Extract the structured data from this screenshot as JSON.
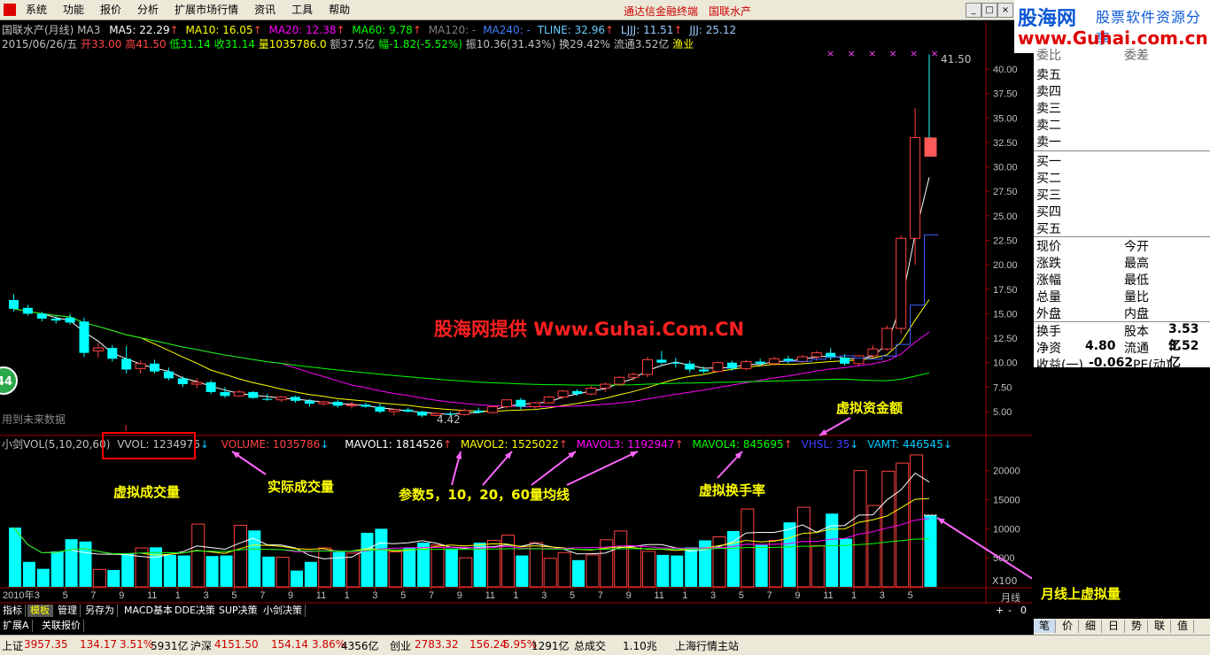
{
  "menu": {
    "items": [
      "系统",
      "功能",
      "报价",
      "分析",
      "扩展市场行情",
      "资讯",
      "工具",
      "帮助"
    ],
    "promo": "通达信金融终端",
    "stock": "国联水产"
  },
  "logo": {
    "name": "股海网",
    "tagline": "股票软件资源分享",
    "url": "www.Guhai.com.cn"
  },
  "chart_header": {
    "title": "国联水产(月线) MA3",
    "ma5": "MA5: 22.29",
    "ma10": "MA10: 16.05",
    "ma20": "MA20: 12.38",
    "ma60": "MA60: 9.78",
    "ma120": "MA120: -",
    "ma240": "MA240: -",
    "tline": "TLINE: 32.96",
    "ljjj": "LJJJ: 11.51",
    "jjj": "JJJ: 25.12"
  },
  "quote": {
    "date": "2015/06/26/五",
    "open": "开33.00",
    "high": "高41.50",
    "low": "低31.14",
    "close": "收31.14",
    "volume": "量1035786.0",
    "amount": "额37.5亿",
    "change": "幅-1.82(-5.52%)",
    "amplitude": "振10.36(31.43%)",
    "turnover": "换29.42%",
    "float": "流通3.52亿",
    "industry": "渔业"
  },
  "price_axis": [
    "40.00",
    "37.50",
    "35.00",
    "32.50",
    "30.00",
    "27.50",
    "25.00",
    "22.50",
    "20.00",
    "17.50",
    "15.00",
    "12.50",
    "10.00",
    "7.50",
    "5.00"
  ],
  "high_label": "41.50",
  "low_label": "4.42",
  "future_note": "用到未来数据",
  "watermark": "股海网提供 Www.Guhai.Com.CN",
  "volume_header": {
    "title": "小剑VOL(5,10,20,60)",
    "vvol": "VVOL: 1234976",
    "volume": "VOLUME: 1035786",
    "mavol1": "MAVOL1: 1814526",
    "mavol2": "MAVOL2: 1525022",
    "mavol3": "MAVOL3: 1192947",
    "mavol4": "MAVOL4: 845695",
    "vhsl": "VHSL: 35",
    "vamt": "VAMT: 446545"
  },
  "volume_axis": [
    "20000",
    "15000",
    "10000",
    "5000"
  ],
  "volume_unit": "X100",
  "time_axis": {
    "first": "2010年",
    "ticks": [
      "3",
      "5",
      "7",
      "9",
      "11",
      "1",
      "3",
      "5",
      "7",
      "9",
      "11",
      "1",
      "3",
      "5",
      "7",
      "9",
      "11",
      "1",
      "3",
      "5",
      "7",
      "9",
      "11",
      "1",
      "3",
      "5",
      "7",
      "9",
      "11",
      "1",
      "3",
      "5"
    ]
  },
  "period_label": "月线",
  "annotations": {
    "virtual_volume": "虚拟成交量",
    "actual_volume": "实际成交量",
    "params": "参数5，10，20，60量均线",
    "virtual_turnover": "虚拟换手率",
    "virtual_amount": "虚拟资金额",
    "monthly_virtual": "月线上虚拟量"
  },
  "tabs": [
    "指标",
    "模板",
    "管理",
    "另存为",
    "MACD基本",
    "DDE决策",
    "SUP决策",
    "小剑决策"
  ],
  "ext_tabs": [
    "扩展A",
    "关联报价"
  ],
  "right_panel": {
    "header": [
      "委比",
      "委差"
    ],
    "sells": [
      "卖五",
      "卖四",
      "卖三",
      "卖二",
      "卖一"
    ],
    "buys": [
      "买一",
      "买二",
      "买三",
      "买四",
      "买五"
    ],
    "stats_left": [
      "现价",
      "涨跌",
      "涨幅",
      "总量",
      "外盘"
    ],
    "stats_right": [
      "今开",
      "最高",
      "最低",
      "量比",
      "内盘"
    ],
    "fund": [
      {
        "k1": "换手",
        "v1": "",
        "k2": "股本",
        "v2": "3.53亿"
      },
      {
        "k1": "净资",
        "v1": "4.80",
        "k2": "流通",
        "v2": "3.52亿"
      },
      {
        "k1": "收益(一)",
        "v1": "-0.062",
        "k2": "PE(动)",
        "v2": ""
      }
    ]
  },
  "right_tabs": [
    "笔",
    "价",
    "细",
    "日",
    "势",
    "联",
    "值"
  ],
  "status": {
    "sh_label": "上证",
    "sh_value": "3957.35",
    "sh_chg": "134.17",
    "sh_pct": "3.51%",
    "sh_amt": "5931亿",
    "sz_label": "沪深",
    "sz_value": "4151.50",
    "sz_chg": "154.14",
    "sz_pct": "3.86%",
    "sz_amt": "4356亿",
    "cy_label": "创业",
    "cy_value": "2783.32",
    "cy_chg": "156.24",
    "cy_pct": "5.95%",
    "cy_amt": "1291亿",
    "total_label": "总成交",
    "total_value": "1.10兆",
    "server": "上海行情主站"
  },
  "chart_data": {
    "type": "candlestick",
    "categories": [
      "2010-01",
      "2010-02",
      "2010-03",
      "2010-04",
      "2010-05",
      "2010-06",
      "2010-07",
      "2010-08",
      "2010-09",
      "2010-10",
      "2010-11",
      "2010-12",
      "2011-01",
      "2011-02",
      "2011-03",
      "2011-04",
      "2011-05",
      "2011-06",
      "2011-07",
      "2011-08",
      "2011-09",
      "2011-10",
      "2011-11",
      "2011-12",
      "2012-01",
      "2012-02",
      "2012-03",
      "2012-04",
      "2012-05",
      "2012-06",
      "2012-07",
      "2012-08",
      "2012-09",
      "2012-10",
      "2012-11",
      "2012-12",
      "2013-01",
      "2013-02",
      "2013-03",
      "2013-04",
      "2013-05",
      "2013-06",
      "2013-07",
      "2013-08",
      "2013-09",
      "2013-10",
      "2013-11",
      "2013-12",
      "2014-01",
      "2014-02",
      "2014-03",
      "2014-04",
      "2014-05",
      "2014-06",
      "2014-07",
      "2014-08",
      "2014-09",
      "2014-10",
      "2014-11",
      "2014-12",
      "2015-01",
      "2015-02",
      "2015-03",
      "2015-04",
      "2015-05",
      "2015-06"
    ],
    "ohlc": [
      [
        16.4,
        17.0,
        15.2,
        15.5
      ],
      [
        15.6,
        15.9,
        14.8,
        15.0
      ],
      [
        15.0,
        15.2,
        14.2,
        14.5
      ],
      [
        14.5,
        14.8,
        14.0,
        14.3
      ],
      [
        14.6,
        15.0,
        13.9,
        14.1
      ],
      [
        14.2,
        14.6,
        10.6,
        11.0
      ],
      [
        11.2,
        12.0,
        10.5,
        11.5
      ],
      [
        11.5,
        11.8,
        10.1,
        10.4
      ],
      [
        10.4,
        11.7,
        8.9,
        9.3
      ],
      [
        9.4,
        10.2,
        8.9,
        9.9
      ],
      [
        9.9,
        10.3,
        8.9,
        9.1
      ],
      [
        9.1,
        9.5,
        8.2,
        8.4
      ],
      [
        8.4,
        8.6,
        7.5,
        7.8
      ],
      [
        7.8,
        8.4,
        7.4,
        8.0
      ],
      [
        8.0,
        8.2,
        6.8,
        7.0
      ],
      [
        7.0,
        7.5,
        6.4,
        6.6
      ],
      [
        6.6,
        7.2,
        6.5,
        7.0
      ],
      [
        7.0,
        7.1,
        6.3,
        6.4
      ],
      [
        6.3,
        6.8,
        6.1,
        6.2
      ],
      [
        6.2,
        6.6,
        6.0,
        6.5
      ],
      [
        6.5,
        6.6,
        5.9,
        6.1
      ],
      [
        6.1,
        6.3,
        5.5,
        5.8
      ],
      [
        5.8,
        6.1,
        5.6,
        6.0
      ],
      [
        6.0,
        6.2,
        5.4,
        5.6
      ],
      [
        5.6,
        6.0,
        5.3,
        5.7
      ],
      [
        5.7,
        5.9,
        5.4,
        5.5
      ],
      [
        5.5,
        5.8,
        4.8,
        5.0
      ],
      [
        5.0,
        5.3,
        4.6,
        5.2
      ],
      [
        5.2,
        5.4,
        4.9,
        5.0
      ],
      [
        5.0,
        5.1,
        4.42,
        4.6
      ],
      [
        4.6,
        4.9,
        4.5,
        4.8
      ],
      [
        4.8,
        5.0,
        4.6,
        4.7
      ],
      [
        4.7,
        5.3,
        4.6,
        5.1
      ],
      [
        5.1,
        5.4,
        4.8,
        4.9
      ],
      [
        4.9,
        5.6,
        4.8,
        5.5
      ],
      [
        5.5,
        6.3,
        5.3,
        6.2
      ],
      [
        6.2,
        6.4,
        5.2,
        5.5
      ],
      [
        5.5,
        6.0,
        5.3,
        5.9
      ],
      [
        5.9,
        6.6,
        5.8,
        6.5
      ],
      [
        6.5,
        7.2,
        6.3,
        7.1
      ],
      [
        7.1,
        7.3,
        6.6,
        6.8
      ],
      [
        6.8,
        7.6,
        6.7,
        7.4
      ],
      [
        7.4,
        8.0,
        7.0,
        7.8
      ],
      [
        7.8,
        8.6,
        7.6,
        8.5
      ],
      [
        8.5,
        9.0,
        8.2,
        8.8
      ],
      [
        8.8,
        10.6,
        8.5,
        10.3
      ],
      [
        10.3,
        11.2,
        9.8,
        10.0
      ],
      [
        10.0,
        10.5,
        9.5,
        9.9
      ],
      [
        9.9,
        10.2,
        9.0,
        9.3
      ],
      [
        9.3,
        9.6,
        8.9,
        9.1
      ],
      [
        9.1,
        10.1,
        9.0,
        10.0
      ],
      [
        10.0,
        10.2,
        9.2,
        9.4
      ],
      [
        9.4,
        10.3,
        9.2,
        10.1
      ],
      [
        10.1,
        10.4,
        9.7,
        9.9
      ],
      [
        9.9,
        10.6,
        9.7,
        10.4
      ],
      [
        10.4,
        10.7,
        9.9,
        10.1
      ],
      [
        10.1,
        10.8,
        9.9,
        10.6
      ],
      [
        10.6,
        11.2,
        10.2,
        11.0
      ],
      [
        11.0,
        11.5,
        10.3,
        10.5
      ],
      [
        10.5,
        10.9,
        9.7,
        9.9
      ],
      [
        9.9,
        10.8,
        9.7,
        10.7
      ],
      [
        10.7,
        11.8,
        10.5,
        11.4
      ],
      [
        11.4,
        13.8,
        11.2,
        13.5
      ],
      [
        13.5,
        23.0,
        13.0,
        22.7
      ],
      [
        22.7,
        36.0,
        20.0,
        33.0
      ],
      [
        33.0,
        41.5,
        31.14,
        31.14
      ]
    ],
    "y_axis": [
      5.0,
      40.0
    ],
    "volume_ylim": [
      0,
      23000
    ]
  }
}
